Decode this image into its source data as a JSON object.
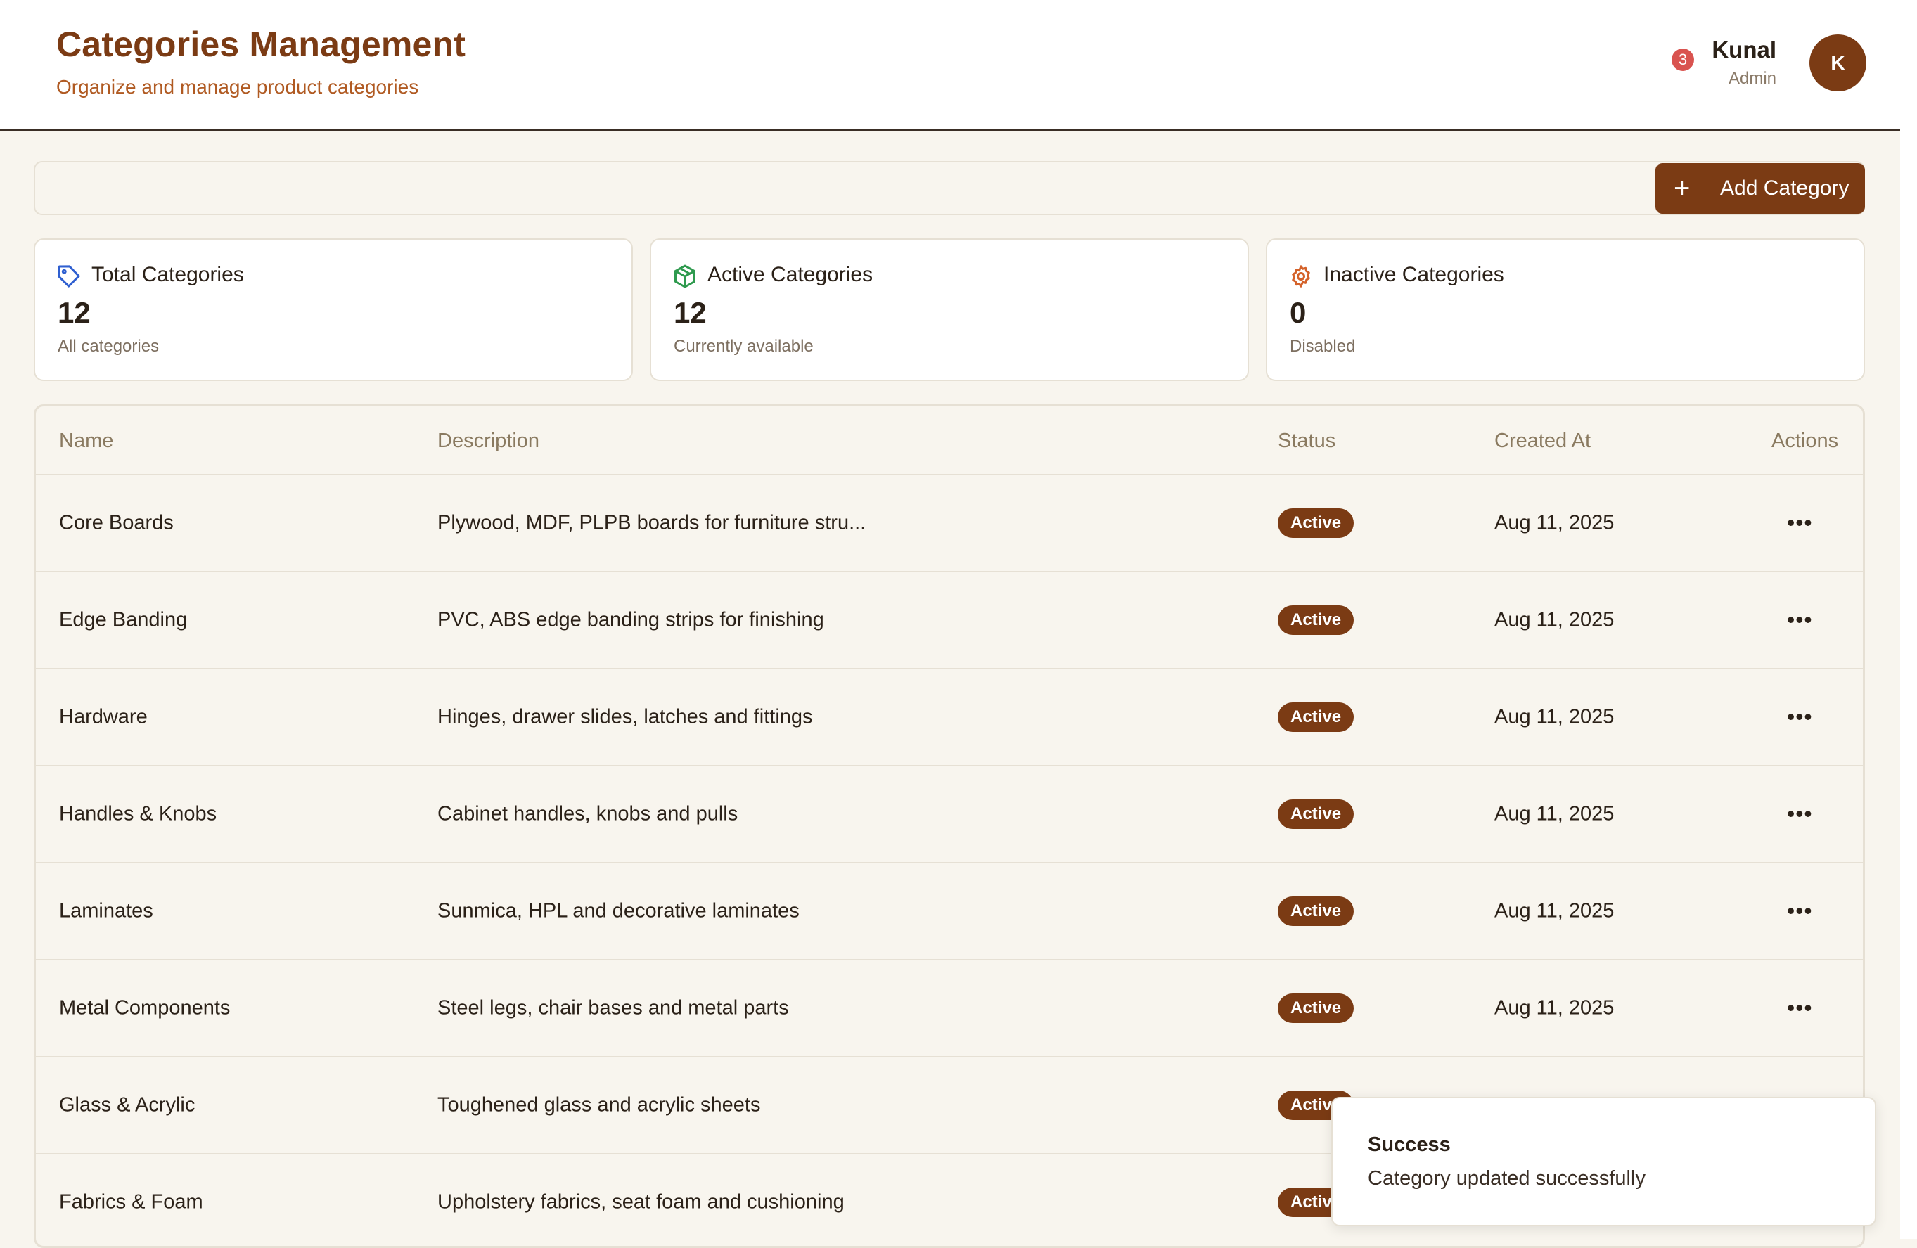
{
  "header": {
    "title": "Categories Management",
    "subtitle": "Organize and manage product categories",
    "notification_count": "3",
    "user_name": "Kunal",
    "user_role": "Admin",
    "avatar_initial": "K"
  },
  "toolbar": {
    "search_value": "",
    "add_label": "Add Category"
  },
  "stats": [
    {
      "title": "Total Categories",
      "value": "12",
      "note": "All categories",
      "icon": "tag-icon",
      "color": "#2f5fd0"
    },
    {
      "title": "Active Categories",
      "value": "12",
      "note": "Currently available",
      "icon": "package-icon",
      "color": "#2e9a4e"
    },
    {
      "title": "Inactive Categories",
      "value": "0",
      "note": "Disabled",
      "icon": "gear-icon",
      "color": "#d4622a"
    }
  ],
  "table": {
    "columns": [
      "Name",
      "Description",
      "Status",
      "Created At",
      "Actions"
    ],
    "rows": [
      {
        "name": "Core Boards",
        "description": "Plywood, MDF, PLPB boards for furniture stru...",
        "status": "Active",
        "created": "Aug 11, 2025"
      },
      {
        "name": "Edge Banding",
        "description": "PVC, ABS edge banding strips for finishing",
        "status": "Active",
        "created": "Aug 11, 2025"
      },
      {
        "name": "Hardware",
        "description": "Hinges, drawer slides, latches and fittings",
        "status": "Active",
        "created": "Aug 11, 2025"
      },
      {
        "name": "Handles & Knobs",
        "description": "Cabinet handles, knobs and pulls",
        "status": "Active",
        "created": "Aug 11, 2025"
      },
      {
        "name": "Laminates",
        "description": "Sunmica, HPL and decorative laminates",
        "status": "Active",
        "created": "Aug 11, 2025"
      },
      {
        "name": "Metal Components",
        "description": "Steel legs, chair bases and metal parts",
        "status": "Active",
        "created": "Aug 11, 2025"
      },
      {
        "name": "Glass & Acrylic",
        "description": "Toughened glass and acrylic sheets",
        "status": "Active",
        "created": ""
      },
      {
        "name": "Fabrics & Foam",
        "description": "Upholstery fabrics, seat foam and cushioning",
        "status": "Active",
        "created": ""
      }
    ],
    "actions_icon": "more-horizontal-icon"
  },
  "toast": {
    "title": "Success",
    "message": "Category updated successfully"
  },
  "colors": {
    "brand": "#7b3b14",
    "accent_text": "#b05a22",
    "background": "#f8f5ee",
    "notification": "#d9534f"
  }
}
